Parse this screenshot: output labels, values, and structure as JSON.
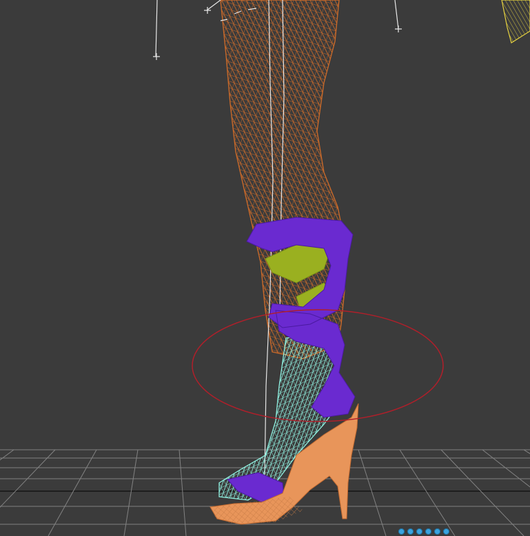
{
  "viewport": {
    "background": "#3b3b3b",
    "grid_color": "#9a9a9a",
    "objects": [
      {
        "name": "leg-mesh",
        "color": "#c8692a"
      },
      {
        "name": "skeleton-bones",
        "color": "#e8e8e8"
      },
      {
        "name": "ribbon-strap",
        "color": "#6a2ad0"
      },
      {
        "name": "ankle-wrap",
        "color": "#9ab020"
      },
      {
        "name": "inner-shoe",
        "color": "#8ff0e0"
      },
      {
        "name": "sandal-sole",
        "color": "#e8955a"
      },
      {
        "name": "hair-strands",
        "color": "#e6d240"
      },
      {
        "name": "selection-circle",
        "color": "#b01f2a"
      }
    ]
  },
  "nav_dots": [
    {
      "name": "nav-dot-1"
    },
    {
      "name": "nav-dot-2"
    },
    {
      "name": "nav-dot-3"
    },
    {
      "name": "nav-dot-4"
    },
    {
      "name": "nav-dot-5"
    },
    {
      "name": "nav-dot-6"
    }
  ]
}
